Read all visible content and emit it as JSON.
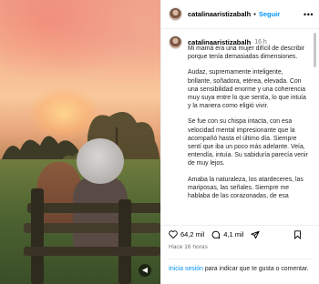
{
  "post": {
    "username": "catalinaaristizabalh",
    "follow_label": "Seguir",
    "separator": "•",
    "more_glyph": "•••",
    "time": "16 h",
    "caption": [
      "Mi mamá era una mujer difícil de describir porque tenía demasiadas dimensiones.",
      "Audaz, supremamente inteligente, brillante, soñadora, etérea, elevada. Con una sensibilidad enorme y una coherencia muy suya entre lo que sentía, lo que intuía y la manera como eligió vivir.",
      "Se fue con su chispa intacta, con esa velocidad mental impresionante que la acompañó hasta el último día. Siempre sentí que iba un poco más adelante. Veía, entendía, intuía. Su sabiduría parecía venir de muy lejos.",
      "Amaba la naturaleza, los atardeceres, las mariposas, las señales. Siempre me hablaba de las corazonadas, de esa"
    ],
    "likes": "64,2 mil",
    "comments": "4,1 mil",
    "ago": "Hace 16 horas",
    "login_link": "Inicia sesión",
    "login_text": " para indicar que te gusta o comentar."
  },
  "icons": {
    "mute": "speaker-muted-icon",
    "like": "heart-icon",
    "comment": "comment-icon",
    "share": "share-icon",
    "save": "bookmark-icon"
  },
  "colors": {
    "accent": "#0095f6",
    "muted": "#737373"
  }
}
